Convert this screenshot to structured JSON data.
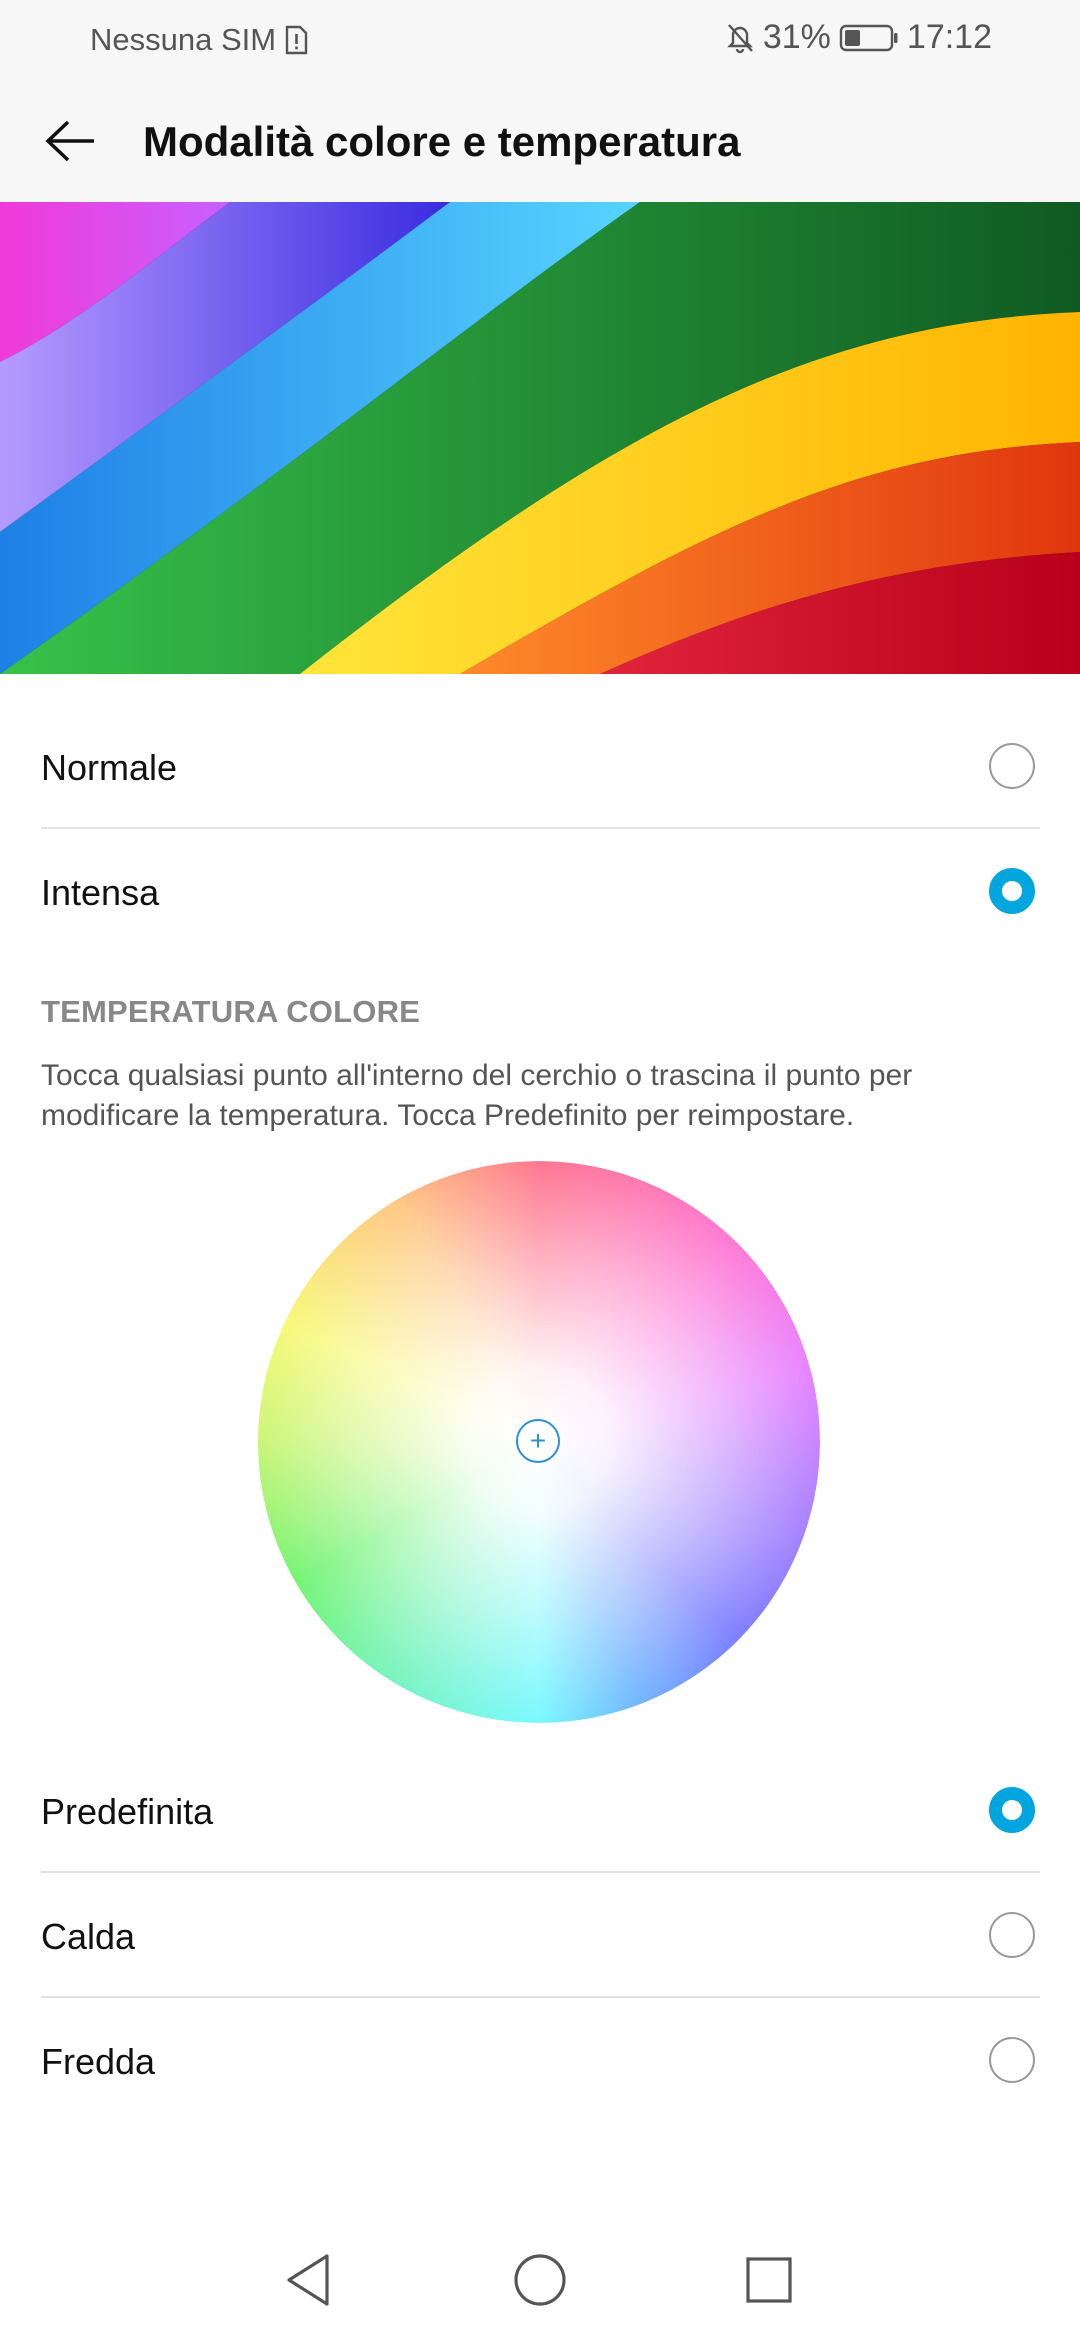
{
  "status_bar": {
    "carrier": "Nessuna SIM",
    "battery": "31%",
    "time": "17:12",
    "icons": [
      "sim-alert-icon",
      "bell-off-icon",
      "battery-icon"
    ]
  },
  "app_bar": {
    "title": "Modalità colore e temperatura",
    "back_icon": "arrow-left-icon"
  },
  "color_mode": {
    "options": [
      {
        "label": "Normale",
        "selected": false
      },
      {
        "label": "Intensa",
        "selected": true
      }
    ]
  },
  "temperature": {
    "heading": "TEMPERATURA COLORE",
    "description": "Tocca qualsiasi punto all'interno del cerchio o trascina il punto per modificare la temperatura. Tocca Predefinito per reimpostare.",
    "handle_symbol": "+",
    "options": [
      {
        "label": "Predefinita",
        "selected": true
      },
      {
        "label": "Calda",
        "selected": false
      },
      {
        "label": "Fredda",
        "selected": false
      }
    ]
  },
  "colors": {
    "accent": "#00a6dd",
    "handle": "#2a8fd6",
    "heading_gray": "#888888"
  },
  "nav_bar": {
    "icons": [
      "back-triangle-icon",
      "home-circle-icon",
      "recents-square-icon"
    ]
  }
}
